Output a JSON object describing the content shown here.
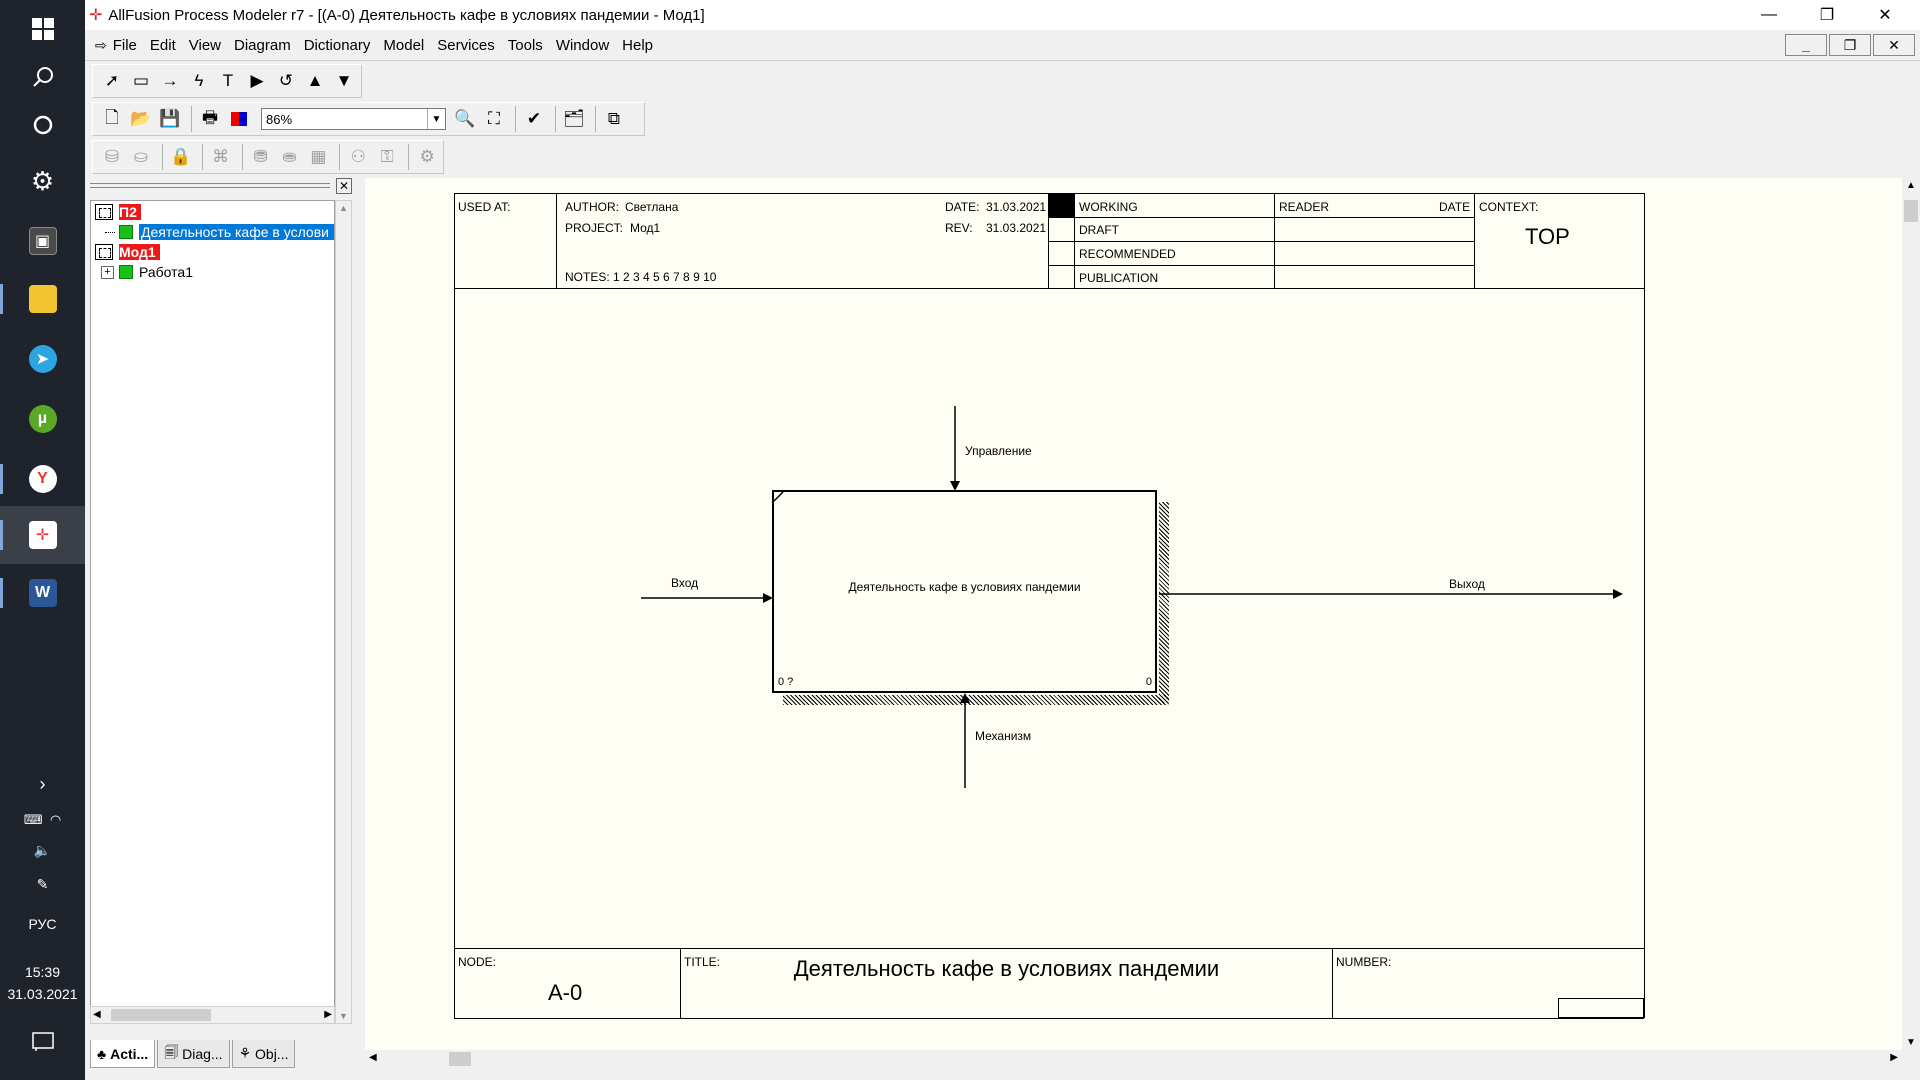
{
  "window": {
    "title": "AllFusion Process Modeler r7 - [(A-0) Деятельность кафе в условиях пандемии - Мод1]",
    "minimize": "—",
    "restore": "❐",
    "close": "✕"
  },
  "menu": {
    "items": [
      "File",
      "Edit",
      "View",
      "Diagram",
      "Dictionary",
      "Model",
      "Services",
      "Tools",
      "Window",
      "Help"
    ]
  },
  "toolbar": {
    "zoom": "86%"
  },
  "explorer": {
    "nodes": [
      {
        "label": "П2"
      },
      {
        "label": "Деятельность кафе в услови"
      },
      {
        "label": "Мод1"
      },
      {
        "label": "Работа1"
      }
    ],
    "tabs": [
      "Acti...",
      "Diag...",
      "Obj..."
    ]
  },
  "diagram": {
    "header": {
      "used_at": "USED AT:",
      "author_label": "AUTHOR:",
      "author": "Светлана",
      "project_label": "PROJECT:",
      "project": "Мод1",
      "date_label": "DATE:",
      "date": "31.03.2021",
      "rev_label": "REV:",
      "rev": "31.03.2021",
      "notes": "NOTES:  1  2  3  4  5  6  7  8  9  10",
      "status": [
        "WORKING",
        "DRAFT",
        "RECOMMENDED",
        "PUBLICATION"
      ],
      "reader": "READER",
      "reader_date": "DATE",
      "context": "CONTEXT:",
      "context_value": "TOP"
    },
    "activity": {
      "name": "Деятельность кафе в условиях пандемии",
      "corner_left": "0 ?",
      "corner_right": "0"
    },
    "arrows": {
      "control": "Управление",
      "input": "Вход",
      "output": "Выход",
      "mechanism": "Механизм"
    },
    "footer": {
      "node_label": "NODE:",
      "node": "A-0",
      "title_label": "TITLE:",
      "title": "Деятельность кафе в условиях пандемии",
      "number_label": "NUMBER:"
    }
  },
  "taskbar": {
    "lang": "РУС",
    "time": "15:39",
    "date": "31.03.2021"
  }
}
